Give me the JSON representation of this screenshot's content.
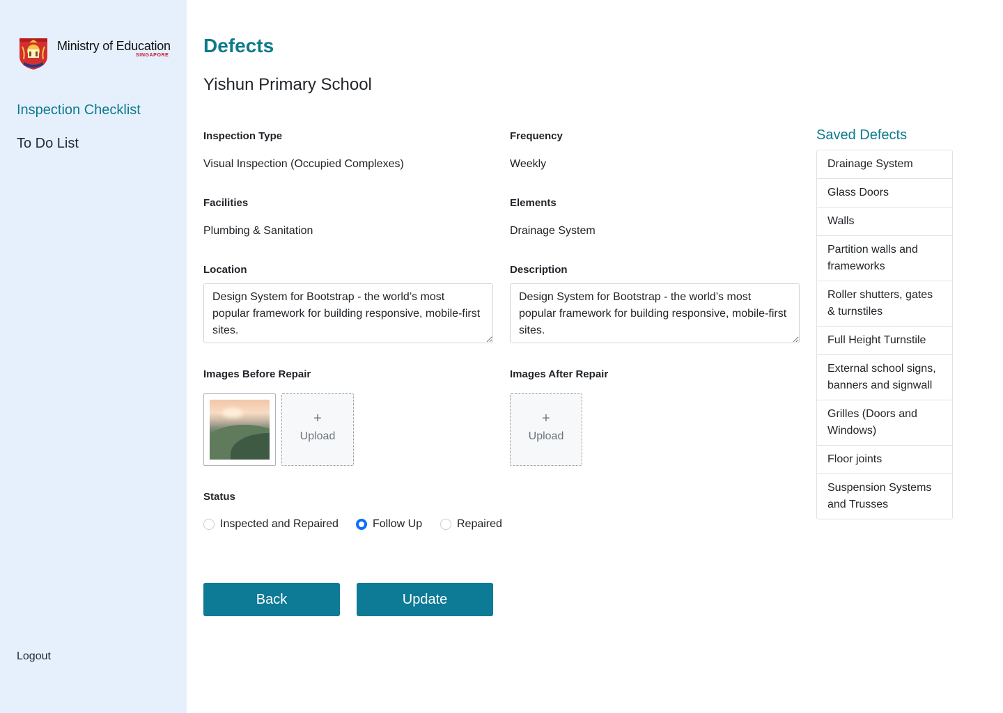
{
  "brand": {
    "name": "Ministry of Education",
    "sub": "SINGAPORE"
  },
  "nav": {
    "items": [
      {
        "label": "Inspection Checklist"
      },
      {
        "label": "To Do List"
      }
    ],
    "logout": "Logout"
  },
  "page": {
    "title": "Defects",
    "school": "Yishun Primary School"
  },
  "fields": {
    "inspection_type": {
      "label": "Inspection Type",
      "value": "Visual Inspection (Occupied Complexes)"
    },
    "frequency": {
      "label": "Frequency",
      "value": "Weekly"
    },
    "facilities": {
      "label": "Facilities",
      "value": "Plumbing & Sanitation"
    },
    "elements": {
      "label": "Elements",
      "value": "Drainage System"
    },
    "location": {
      "label": "Location",
      "value": "Design System for Bootstrap - the world’s most popular framework for building responsive, mobile-first sites."
    },
    "description": {
      "label": "Description",
      "value": "Design System for Bootstrap - the world’s most popular framework for building responsive, mobile-first sites."
    }
  },
  "images": {
    "before_label": "Images Before Repair",
    "after_label": "Images After Repair",
    "upload_plus": "+",
    "upload_label": "Upload"
  },
  "status": {
    "label": "Status",
    "options": [
      {
        "label": "Inspected and Repaired",
        "checked": false
      },
      {
        "label": "Follow Up",
        "checked": true
      },
      {
        "label": "Repaired",
        "checked": false
      }
    ]
  },
  "buttons": {
    "back": "Back",
    "update": "Update"
  },
  "saved_defects": {
    "title": "Saved Defects",
    "items": [
      "Drainage System",
      "Glass Doors",
      "Walls",
      "Partition walls and frameworks",
      "Roller shutters, gates & turnstiles",
      "Full Height Turnstile",
      "External school signs, banners and signwall",
      "Grilles (Doors and Windows)",
      "Floor joints",
      "Suspension Systems and Trusses"
    ]
  },
  "colors": {
    "accent": "#0d7a8c",
    "button": "#0d7a96",
    "sidebar": "#e6f0fd",
    "radio_checked": "#0d6efd"
  }
}
